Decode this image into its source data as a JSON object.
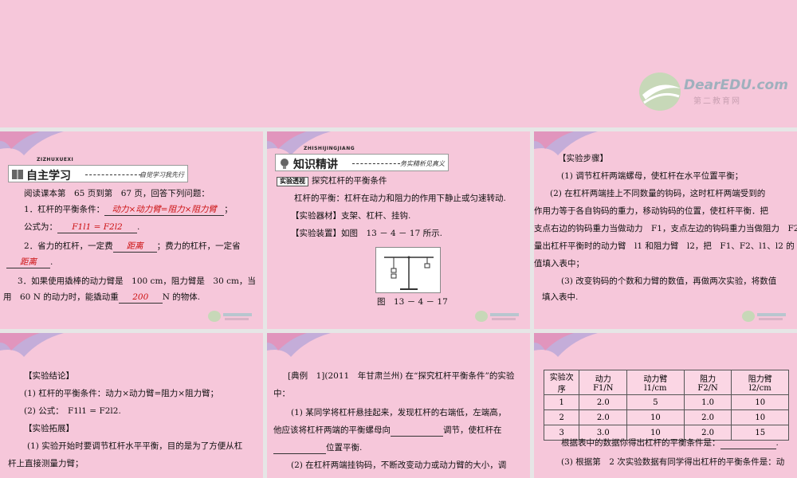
{
  "logo": {
    "brand": "DearEDU.com",
    "sub": "第二教育网"
  },
  "slide1": {
    "header_pinyin": "ZIZHUXUEXI",
    "header_title": "自主学习",
    "header_tag": "自觉学习我先行",
    "intro": "阅读课本第　65 页到第　67 页，回答下列问题：",
    "q1_prefix": "1．杠杆的平衡条件：",
    "q1_answer": "动力×动力臂=阻力×阻力臂",
    "q1_suffix": "；",
    "q1b_prefix": "公式为：",
    "q1b_answer": "F1l1 = F2l2",
    "q1b_suffix": ".",
    "q2_prefix": "2．省力的杠杆，一定费",
    "q2_answer1": "距离",
    "q2_mid": "；费力的杠杆，一定省",
    "q2_answer2": "距离",
    "q2_suffix": ".",
    "q3_line1": "3．如果使用撬棒的动力臂是　100 cm，阻力臂是　30 cm，当",
    "q3_line2_prefix": "用　60 N 的动力时，能撬动重",
    "q3_answer": "200",
    "q3_suffix": "N 的物体."
  },
  "slide2": {
    "header_pinyin": "ZHISHIJINGJIANG",
    "header_title": "知识精讲",
    "header_tag": "务实精析见真义",
    "badge": "实验透视",
    "subtitle": "探究杠杆的平衡条件",
    "line1": "杠杆的平衡：杠杆在动力和阻力的作用下静止或匀速转动.",
    "line2": "【实验器材】支架、杠杆、挂钩.",
    "line3": "【实验装置】如图　13 － 4 － 17 所示.",
    "figure_caption": "图　13 － 4 － 17"
  },
  "slide3": {
    "title": "【实验步骤】",
    "l1": "(1) 调节杠杆两端螺母，使杠杆在水平位置平衡；",
    "l2": "(2) 在杠杆两端挂上不同数量的钩码，这时杠杆两端受到的",
    "l3": "作用力等于各自钩码的重力，移动钩码的位置，使杠杆平衡．把",
    "l4": "支点右边的钩码重力当做动力　F1，支点左边的钩码重力当做阻力　F2，",
    "l5": "量出杠杆平衡时的动力臂　l1 和阻力臂　l2，把　F1、F2、l1、l2 的",
    "l6": "值填入表中；",
    "l7": "(3) 改变钩码的个数和力臂的数值，再做两次实验，将数值",
    "l8": "填入表中."
  },
  "slide4": {
    "title": "【实验结论】",
    "l1": "(1) 杠杆的平衡条件：动力×动力臂=阻力×阻力臂；",
    "l2": "(2) 公式：　F1l1 = F2l2.",
    "title2": "【实验拓展】",
    "l3": "(1) 实验开始时要调节杠杆水平平衡，目的是为了方便从杠",
    "l4": "杆上直接测量力臂；"
  },
  "slide5": {
    "l1": "[典例　1](2011　年甘肃兰州) 在“探究杠杆平衡条件”的实验",
    "l2": "中：",
    "l3": "(1) 某同学将杠杆悬挂起来，发现杠杆的右端低，左端高，",
    "l4_prefix": "他应该将杠杆两端的平衡螺母向",
    "l4_suffix": "调节，使杠杆在",
    "l5_suffix": "位置平衡.",
    "l6": "(2) 在杠杆两端挂钩码，不断改变动力或动力臂的大小，调"
  },
  "slide6": {
    "headers": [
      "实验次序",
      "动力　F1/N",
      "动力臂　l1/cm",
      "阻力　F2/N",
      "阻力臂　l2/cm"
    ],
    "rows": [
      [
        "1",
        "2.0",
        "5",
        "1.0",
        "10"
      ],
      [
        "2",
        "2.0",
        "10",
        "2.0",
        "10"
      ],
      [
        "3",
        "3.0",
        "10",
        "2.0",
        "15"
      ]
    ],
    "l1_prefix": "根据表中的数据你得出杠杆的平衡条件是：",
    "l1_suffix": ".",
    "l2": "(3) 根据第　2 次实验数据有同学得出杠杆的平衡条件是：动"
  },
  "colors": {
    "slide_bg": "#f6c7da",
    "answer": "#cc1010",
    "gutter": "#e6e6e6"
  }
}
